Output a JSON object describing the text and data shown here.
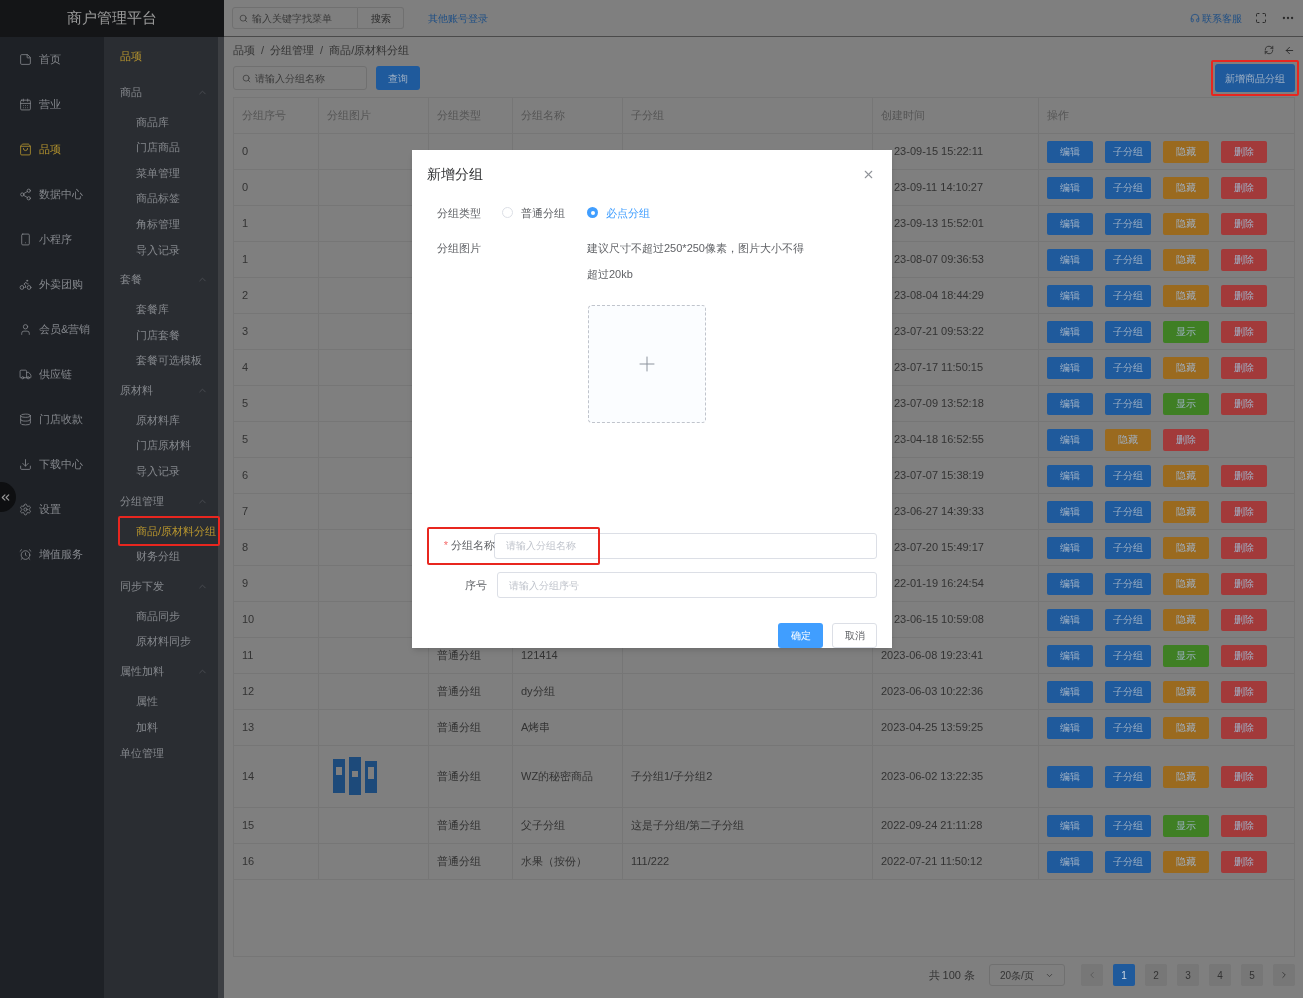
{
  "app": {
    "title": "商户管理平台"
  },
  "nav": [
    {
      "label": "首页",
      "selected": false
    },
    {
      "label": "营业",
      "selected": false
    },
    {
      "label": "品项",
      "selected": true
    },
    {
      "label": "数据中心",
      "selected": false
    },
    {
      "label": "小程序",
      "selected": false
    },
    {
      "label": "外卖团购",
      "selected": false
    },
    {
      "label": "会员&营销",
      "selected": false
    },
    {
      "label": "供应链",
      "selected": false
    },
    {
      "label": "门店收款",
      "selected": false
    },
    {
      "label": "下载中心",
      "selected": false
    },
    {
      "label": "设置",
      "selected": false
    },
    {
      "label": "增值服务",
      "selected": false
    }
  ],
  "submenu": {
    "title": "品项",
    "groups": [
      {
        "kind": "group",
        "label": "商品",
        "expanded": true,
        "items": [
          {
            "label": "商品库",
            "selected": false,
            "highlighted": false
          },
          {
            "label": "门店商品",
            "selected": false,
            "highlighted": false
          },
          {
            "label": "菜单管理",
            "selected": false,
            "highlighted": false
          },
          {
            "label": "商品标签",
            "selected": false,
            "highlighted": false
          },
          {
            "label": "角标管理",
            "selected": false,
            "highlighted": false
          },
          {
            "label": "导入记录",
            "selected": false,
            "highlighted": false
          }
        ]
      },
      {
        "kind": "group",
        "label": "套餐",
        "expanded": true,
        "items": [
          {
            "label": "套餐库",
            "selected": false,
            "highlighted": false
          },
          {
            "label": "门店套餐",
            "selected": false,
            "highlighted": false
          },
          {
            "label": "套餐可选模板",
            "selected": false,
            "highlighted": false
          }
        ]
      },
      {
        "kind": "group",
        "label": "原材料",
        "expanded": true,
        "items": [
          {
            "label": "原材料库",
            "selected": false,
            "highlighted": false
          },
          {
            "label": "门店原材料",
            "selected": false,
            "highlighted": false
          },
          {
            "label": "导入记录",
            "selected": false,
            "highlighted": false
          }
        ]
      },
      {
        "kind": "group",
        "label": "分组管理",
        "expanded": true,
        "items": [
          {
            "label": "商品/原材料分组",
            "selected": true,
            "highlighted": true
          },
          {
            "label": "财务分组",
            "selected": false,
            "highlighted": false
          }
        ]
      },
      {
        "kind": "group",
        "label": "同步下发",
        "expanded": true,
        "items": [
          {
            "label": "商品同步",
            "selected": false,
            "highlighted": false
          },
          {
            "label": "原材料同步",
            "selected": false,
            "highlighted": false
          }
        ]
      },
      {
        "kind": "group",
        "label": "属性加料",
        "expanded": true,
        "items": [
          {
            "label": "属性",
            "selected": false,
            "highlighted": false
          },
          {
            "label": "加料",
            "selected": false,
            "highlighted": false
          }
        ]
      },
      {
        "kind": "link",
        "label": "单位管理"
      }
    ]
  },
  "header": {
    "search": {
      "placeholder": "输入关键字找菜单",
      "button": "搜索"
    },
    "account_link": "其他账号登录",
    "support": "联系客服"
  },
  "breadcrumb": {
    "separator": "/",
    "items": [
      "品项",
      "分组管理",
      "商品/原材料分组"
    ]
  },
  "filter": {
    "placeholder": "请输入分组名称",
    "button": "查询"
  },
  "add_button": {
    "label": "新增商品分组",
    "highlighted": true
  },
  "table": {
    "columns": [
      "分组序号",
      "分组图片",
      "分组类型",
      "分组名称",
      "子分组",
      "创建时间",
      "操作"
    ],
    "rows": [
      {
        "kind": "covered",
        "seq": "0",
        "created": "23-09-15 15:22:11",
        "actions": [
          {
            "kind": "edit",
            "label": "编辑"
          },
          {
            "kind": "sub",
            "label": "子分组"
          },
          {
            "kind": "hide",
            "label": "隐藏"
          },
          {
            "kind": "delete",
            "label": "删除"
          }
        ]
      },
      {
        "kind": "covered",
        "seq": "0",
        "created": "23-09-11 14:10:27",
        "actions": [
          {
            "kind": "edit",
            "label": "编辑"
          },
          {
            "kind": "sub",
            "label": "子分组"
          },
          {
            "kind": "hide",
            "label": "隐藏"
          },
          {
            "kind": "delete",
            "label": "删除"
          }
        ]
      },
      {
        "kind": "covered",
        "seq": "1",
        "created": "23-09-13 15:52:01",
        "actions": [
          {
            "kind": "edit",
            "label": "编辑"
          },
          {
            "kind": "sub",
            "label": "子分组"
          },
          {
            "kind": "hide",
            "label": "隐藏"
          },
          {
            "kind": "delete",
            "label": "删除"
          }
        ]
      },
      {
        "kind": "covered",
        "seq": "1",
        "created": "23-08-07 09:36:53",
        "actions": [
          {
            "kind": "edit",
            "label": "编辑"
          },
          {
            "kind": "sub",
            "label": "子分组"
          },
          {
            "kind": "hide",
            "label": "隐藏"
          },
          {
            "kind": "delete",
            "label": "删除"
          }
        ]
      },
      {
        "kind": "covered",
        "seq": "2",
        "created": "23-08-04 18:44:29",
        "actions": [
          {
            "kind": "edit",
            "label": "编辑"
          },
          {
            "kind": "sub",
            "label": "子分组"
          },
          {
            "kind": "hide",
            "label": "隐藏"
          },
          {
            "kind": "delete",
            "label": "删除"
          }
        ]
      },
      {
        "kind": "covered",
        "seq": "3",
        "created": "23-07-21 09:53:22",
        "actions": [
          {
            "kind": "edit",
            "label": "编辑"
          },
          {
            "kind": "sub",
            "label": "子分组"
          },
          {
            "kind": "show",
            "label": "显示"
          },
          {
            "kind": "delete",
            "label": "删除"
          }
        ]
      },
      {
        "kind": "covered",
        "seq": "4",
        "created": "23-07-17 11:50:15",
        "actions": [
          {
            "kind": "edit",
            "label": "编辑"
          },
          {
            "kind": "sub",
            "label": "子分组"
          },
          {
            "kind": "hide",
            "label": "隐藏"
          },
          {
            "kind": "delete",
            "label": "删除"
          }
        ]
      },
      {
        "kind": "covered",
        "seq": "5",
        "created": "23-07-09 13:52:18",
        "actions": [
          {
            "kind": "edit",
            "label": "编辑"
          },
          {
            "kind": "sub",
            "label": "子分组"
          },
          {
            "kind": "show",
            "label": "显示"
          },
          {
            "kind": "delete",
            "label": "删除"
          }
        ]
      },
      {
        "kind": "covered",
        "seq": "5",
        "created": "23-04-18 16:52:55",
        "actions": [
          {
            "kind": "edit",
            "label": "编辑"
          },
          {
            "kind": "hide",
            "label": "隐藏"
          },
          {
            "kind": "delete",
            "label": "删除"
          }
        ]
      },
      {
        "kind": "covered",
        "seq": "6",
        "created": "23-07-07 15:38:19",
        "actions": [
          {
            "kind": "edit",
            "label": "编辑"
          },
          {
            "kind": "sub",
            "label": "子分组"
          },
          {
            "kind": "hide",
            "label": "隐藏"
          },
          {
            "kind": "delete",
            "label": "删除"
          }
        ]
      },
      {
        "kind": "covered",
        "seq": "7",
        "created": "23-06-27 14:39:33",
        "actions": [
          {
            "kind": "edit",
            "label": "编辑"
          },
          {
            "kind": "sub",
            "label": "子分组"
          },
          {
            "kind": "hide",
            "label": "隐藏"
          },
          {
            "kind": "delete",
            "label": "删除"
          }
        ]
      },
      {
        "kind": "covered",
        "seq": "8",
        "created": "23-07-20 15:49:17",
        "actions": [
          {
            "kind": "edit",
            "label": "编辑"
          },
          {
            "kind": "sub",
            "label": "子分组"
          },
          {
            "kind": "hide",
            "label": "隐藏"
          },
          {
            "kind": "delete",
            "label": "删除"
          }
        ]
      },
      {
        "kind": "covered",
        "seq": "9",
        "created": "22-01-19 16:24:54",
        "actions": [
          {
            "kind": "edit",
            "label": "编辑"
          },
          {
            "kind": "sub",
            "label": "子分组"
          },
          {
            "kind": "hide",
            "label": "隐藏"
          },
          {
            "kind": "delete",
            "label": "删除"
          }
        ]
      },
      {
        "kind": "covered",
        "seq": "10",
        "created": "23-06-15 10:59:08",
        "actions": [
          {
            "kind": "edit",
            "label": "编辑"
          },
          {
            "kind": "sub",
            "label": "子分组"
          },
          {
            "kind": "hide",
            "label": "隐藏"
          },
          {
            "kind": "delete",
            "label": "删除"
          }
        ]
      },
      {
        "kind": "full",
        "seq": "11",
        "type": "普通分组",
        "name": "121414",
        "created": "2023-06-08 19:23:41",
        "actions": [
          {
            "kind": "edit",
            "label": "编辑"
          },
          {
            "kind": "sub",
            "label": "子分组"
          },
          {
            "kind": "show",
            "label": "显示"
          },
          {
            "kind": "delete",
            "label": "删除"
          }
        ]
      },
      {
        "kind": "full",
        "seq": "12",
        "type": "普通分组",
        "name": "dy分组",
        "created": "2023-06-03 10:22:36",
        "actions": [
          {
            "kind": "edit",
            "label": "编辑"
          },
          {
            "kind": "sub",
            "label": "子分组"
          },
          {
            "kind": "hide",
            "label": "隐藏"
          },
          {
            "kind": "delete",
            "label": "删除"
          }
        ]
      },
      {
        "kind": "full",
        "seq": "13",
        "type": "普通分组",
        "name": "A烤串",
        "created": "2023-04-25 13:59:25",
        "actions": [
          {
            "kind": "edit",
            "label": "编辑"
          },
          {
            "kind": "sub",
            "label": "子分组"
          },
          {
            "kind": "hide",
            "label": "隐藏"
          },
          {
            "kind": "delete",
            "label": "删除"
          }
        ]
      },
      {
        "kind": "full",
        "seq": "14",
        "image": {
          "kind": "picture"
        },
        "type": "普通分组",
        "name": "WZ的秘密商品",
        "sub": "子分组1/子分组2",
        "created": "2023-06-02 13:22:35",
        "actions": [
          {
            "kind": "edit",
            "label": "编辑"
          },
          {
            "kind": "sub",
            "label": "子分组"
          },
          {
            "kind": "hide",
            "label": "隐藏"
          },
          {
            "kind": "delete",
            "label": "删除"
          }
        ]
      },
      {
        "kind": "full",
        "seq": "15",
        "type": "普通分组",
        "name": "父子分组",
        "sub": "这是子分组/第二子分组",
        "created": "2022-09-24 21:11:28",
        "actions": [
          {
            "kind": "edit",
            "label": "编辑"
          },
          {
            "kind": "sub",
            "label": "子分组"
          },
          {
            "kind": "show",
            "label": "显示"
          },
          {
            "kind": "delete",
            "label": "删除"
          }
        ]
      },
      {
        "kind": "full",
        "seq": "16",
        "type": "普通分组",
        "name": "水果（按份）",
        "sub": "111/222",
        "created": "2022-07-21 11:50:12",
        "actions": [
          {
            "kind": "edit",
            "label": "编辑"
          },
          {
            "kind": "sub",
            "label": "子分组"
          },
          {
            "kind": "hide",
            "label": "隐藏"
          },
          {
            "kind": "delete",
            "label": "删除"
          }
        ]
      }
    ]
  },
  "pagination": {
    "total": "共 100 条",
    "page_size": "20条/页",
    "pages": [
      {
        "label": "1",
        "selected": true
      },
      {
        "label": "2",
        "selected": false
      },
      {
        "label": "3",
        "selected": false
      },
      {
        "label": "4",
        "selected": false
      },
      {
        "label": "5",
        "selected": false
      }
    ]
  },
  "dialog": {
    "title": "新增分组",
    "type_field": {
      "label": "分组类型",
      "options": [
        {
          "label": "普通分组",
          "selected": false
        },
        {
          "label": "必点分组",
          "selected": true
        }
      ]
    },
    "image_field": {
      "label": "分组图片",
      "hint": "建议尺寸不超过250*250像素，图片大小不得超过20kb"
    },
    "name_field": {
      "label": "分组名称",
      "required_mark": "*",
      "placeholder": "请输入分组名称",
      "highlighted": true
    },
    "seq_field": {
      "label": "序号",
      "placeholder": "请输入分组序号"
    },
    "buttons": [
      {
        "kind": "primary",
        "label": "确定"
      },
      {
        "kind": "default",
        "label": "取消"
      }
    ]
  }
}
